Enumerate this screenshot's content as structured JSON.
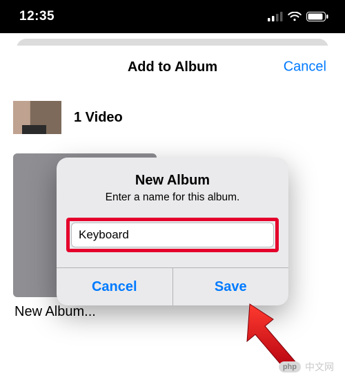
{
  "status": {
    "time": "12:35"
  },
  "sheet": {
    "title": "Add to Album",
    "cancel": "Cancel",
    "media_count_label": "1 Video",
    "new_album_label": "New Album..."
  },
  "alert": {
    "title": "New Album",
    "subtitle": "Enter a name for this album.",
    "input_value": "Keyboard",
    "cancel": "Cancel",
    "save": "Save"
  },
  "watermark": {
    "badge": "php",
    "text": "中文网"
  }
}
